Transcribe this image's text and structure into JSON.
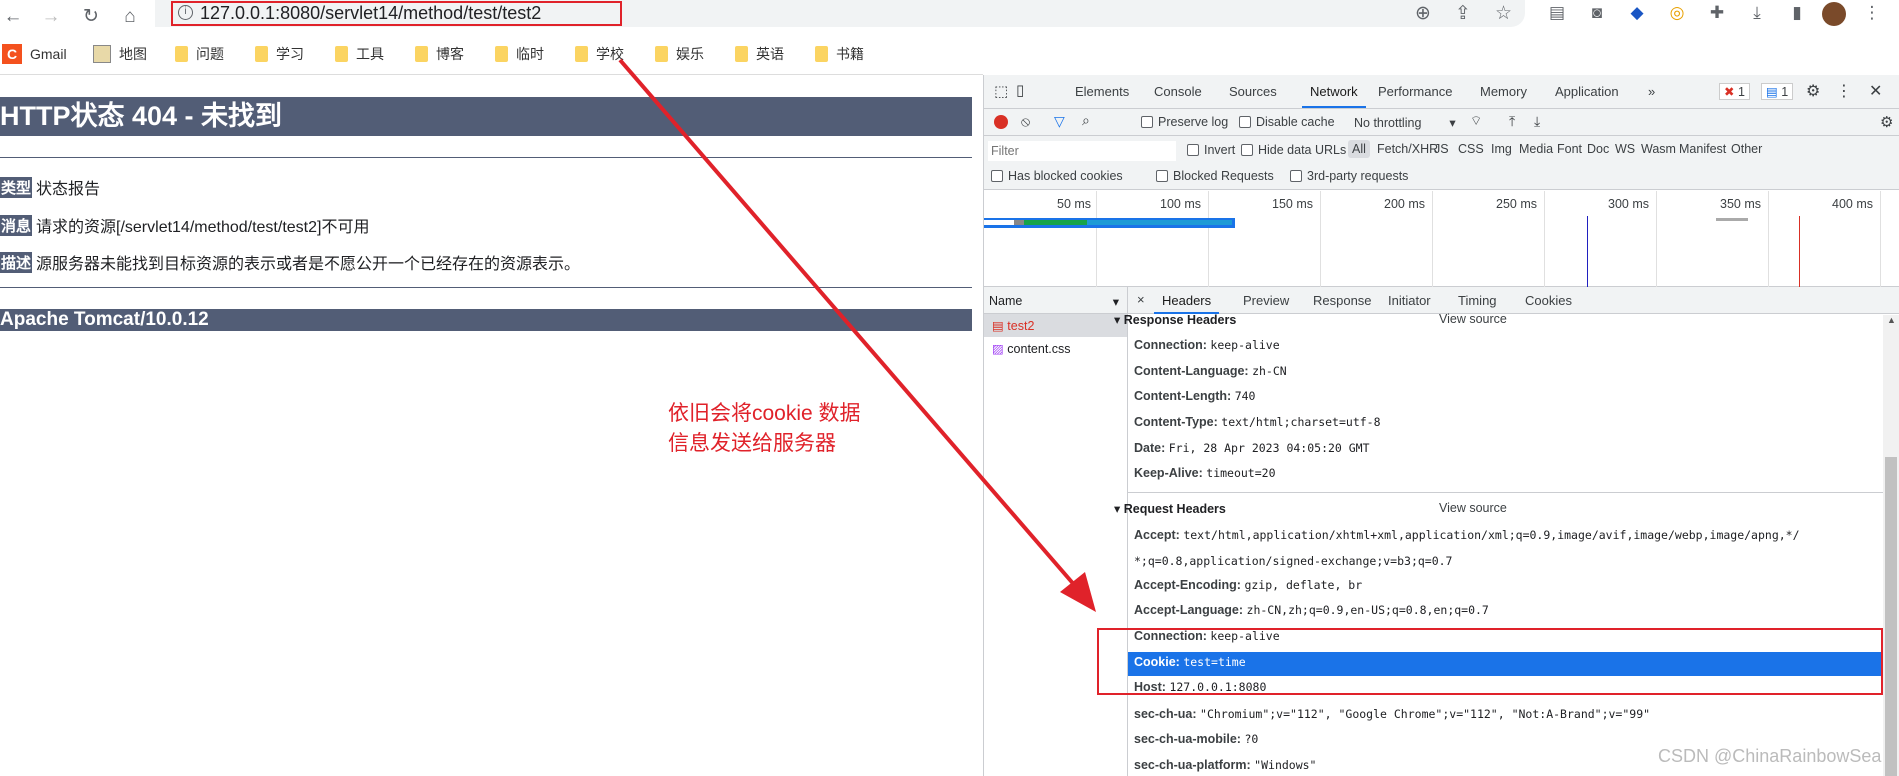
{
  "browser": {
    "url": "127.0.0.1:8080/servlet14/method/test/test2",
    "bookmarks": [
      {
        "label": "Gmail",
        "icon": "gmail-icon"
      },
      {
        "label": "地图",
        "icon": "map-icon"
      },
      {
        "label": "问题",
        "icon": "folder-icon"
      },
      {
        "label": "学习",
        "icon": "folder-icon"
      },
      {
        "label": "工具",
        "icon": "folder-icon"
      },
      {
        "label": "博客",
        "icon": "folder-icon"
      },
      {
        "label": "临时",
        "icon": "folder-icon"
      },
      {
        "label": "学校",
        "icon": "folder-icon"
      },
      {
        "label": "娱乐",
        "icon": "folder-icon"
      },
      {
        "label": "英语",
        "icon": "folder-icon"
      },
      {
        "label": "书籍",
        "icon": "folder-icon"
      }
    ]
  },
  "page": {
    "title": "HTTP状态 404 - 未找到",
    "rows": [
      {
        "label": "类型",
        "text": "状态报告"
      },
      {
        "label": "消息",
        "text": "请求的资源[/servlet14/method/test/test2]不可用"
      },
      {
        "label": "描述",
        "text": "源服务器未能找到目标资源的表示或者是不愿公开一个已经存在的资源表示。"
      }
    ],
    "footer": "Apache Tomcat/10.0.12"
  },
  "annotation": {
    "line1": "依旧会将cookie 数据",
    "line2": "信息发送给服务器",
    "color": "#e0222a"
  },
  "devtools": {
    "tabs": [
      "Elements",
      "Console",
      "Sources",
      "Network",
      "Performance",
      "Memory",
      "Application"
    ],
    "active_tab": "Network",
    "error_count": "1",
    "message_count": "1",
    "toolbar": {
      "preserve_log": "Preserve log",
      "disable_cache": "Disable cache",
      "throttling": "No throttling"
    },
    "filter": {
      "placeholder": "Filter",
      "invert": "Invert",
      "hide_data_urls": "Hide data URLs",
      "types": [
        "All",
        "Fetch/XHR",
        "JS",
        "CSS",
        "Img",
        "Media",
        "Font",
        "Doc",
        "WS",
        "Wasm",
        "Manifest",
        "Other"
      ]
    },
    "checks": [
      "Has blocked cookies",
      "Blocked Requests",
      "3rd-party requests"
    ],
    "timeline_ticks": [
      "50 ms",
      "100 ms",
      "150 ms",
      "200 ms",
      "250 ms",
      "300 ms",
      "350 ms",
      "400 ms"
    ],
    "name_header": "Name",
    "requests": [
      {
        "name": "test2",
        "selected": true
      },
      {
        "name": "content.css",
        "selected": false
      }
    ],
    "detail_tabs": [
      "Headers",
      "Preview",
      "Response",
      "Initiator",
      "Timing",
      "Cookies"
    ],
    "response_headers_title": "Response Headers",
    "request_headers_title": "Request Headers",
    "view_source": "View source",
    "response_headers": [
      {
        "k": "Connection:",
        "v": "keep-alive"
      },
      {
        "k": "Content-Language:",
        "v": "zh-CN"
      },
      {
        "k": "Content-Length:",
        "v": "740"
      },
      {
        "k": "Content-Type:",
        "v": "text/html;charset=utf-8"
      },
      {
        "k": "Date:",
        "v": "Fri, 28 Apr 2023 04:05:20 GMT"
      },
      {
        "k": "Keep-Alive:",
        "v": "timeout=20"
      }
    ],
    "request_headers": [
      {
        "k": "Accept:",
        "v": "text/html,application/xhtml+xml,application/xml;q=0.9,image/avif,image/webp,image/apng,*/"
      },
      {
        "k": "",
        "v": "*;q=0.8,application/signed-exchange;v=b3;q=0.7"
      },
      {
        "k": "Accept-Encoding:",
        "v": "gzip, deflate, br"
      },
      {
        "k": "Accept-Language:",
        "v": "zh-CN,zh;q=0.9,en-US;q=0.8,en;q=0.7"
      },
      {
        "k": "Connection:",
        "v": "keep-alive"
      },
      {
        "k": "Cookie:",
        "v": "test=time",
        "highlight": true
      },
      {
        "k": "Host:",
        "v": "127.0.0.1:8080"
      },
      {
        "k": "sec-ch-ua:",
        "v": "\"Chromium\";v=\"112\", \"Google Chrome\";v=\"112\", \"Not:A-Brand\";v=\"99\""
      },
      {
        "k": "sec-ch-ua-mobile:",
        "v": "?0"
      },
      {
        "k": "sec-ch-ua-platform:",
        "v": "\"Windows\""
      }
    ]
  },
  "watermark": "CSDN @ChinaRainbowSea"
}
